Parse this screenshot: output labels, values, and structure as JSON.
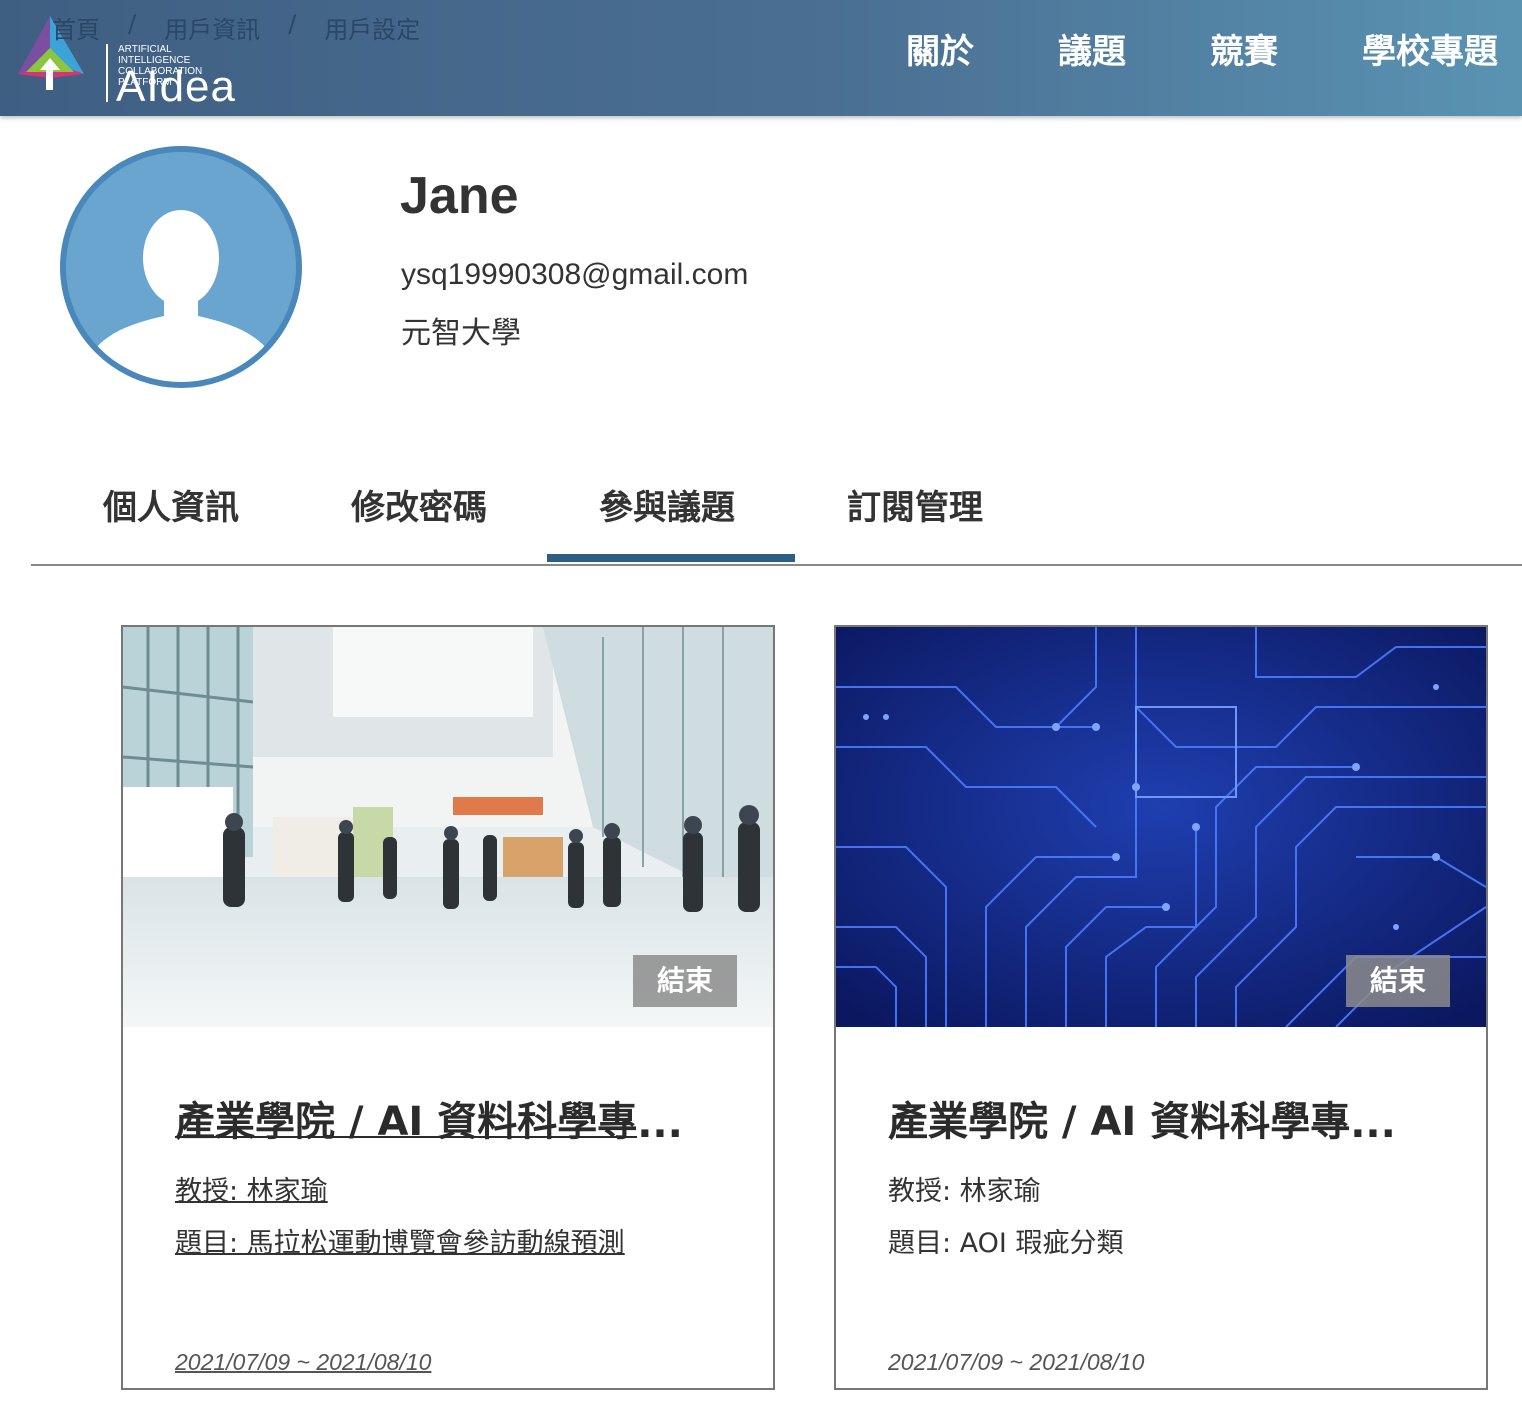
{
  "breadcrumb": [
    "首頁",
    "用戶資訊",
    "用戶設定"
  ],
  "logo": {
    "line1": "ARTIFICIAL INTELLIGENCE",
    "line2": "COLLABORATION PLATFORM",
    "name": "AIdea"
  },
  "nav": [
    "關於",
    "議題",
    "競賽",
    "學校專題"
  ],
  "profile": {
    "name": "Jane",
    "email": "ysq19990308@gmail.com",
    "school": "元智大學"
  },
  "tabs": [
    "個人資訊",
    "修改密碼",
    "參與議題",
    "訂閱管理"
  ],
  "active_tab": "參與議題",
  "colors": {
    "header_start": "#3f5f82",
    "header_end": "#5a93b2",
    "tab_active": "#2d5f86",
    "avatar": "#5b9cc7"
  },
  "cards": [
    {
      "status": "結束",
      "title": "產業學院 / AI 資料科學專",
      "ellipsis": "...",
      "professor": "教授: 林家瑜",
      "topic": "題目: 馬拉松運動博覽會參訪動線預測",
      "dates": "2021/07/09 ~ 2021/08/10"
    },
    {
      "status": "結束",
      "title": "產業學院 / AI 資料科學專",
      "ellipsis": "...",
      "professor": "教授: 林家瑜",
      "topic": "題目: AOI 瑕疵分類",
      "dates": "2021/07/09 ~ 2021/08/10"
    }
  ]
}
